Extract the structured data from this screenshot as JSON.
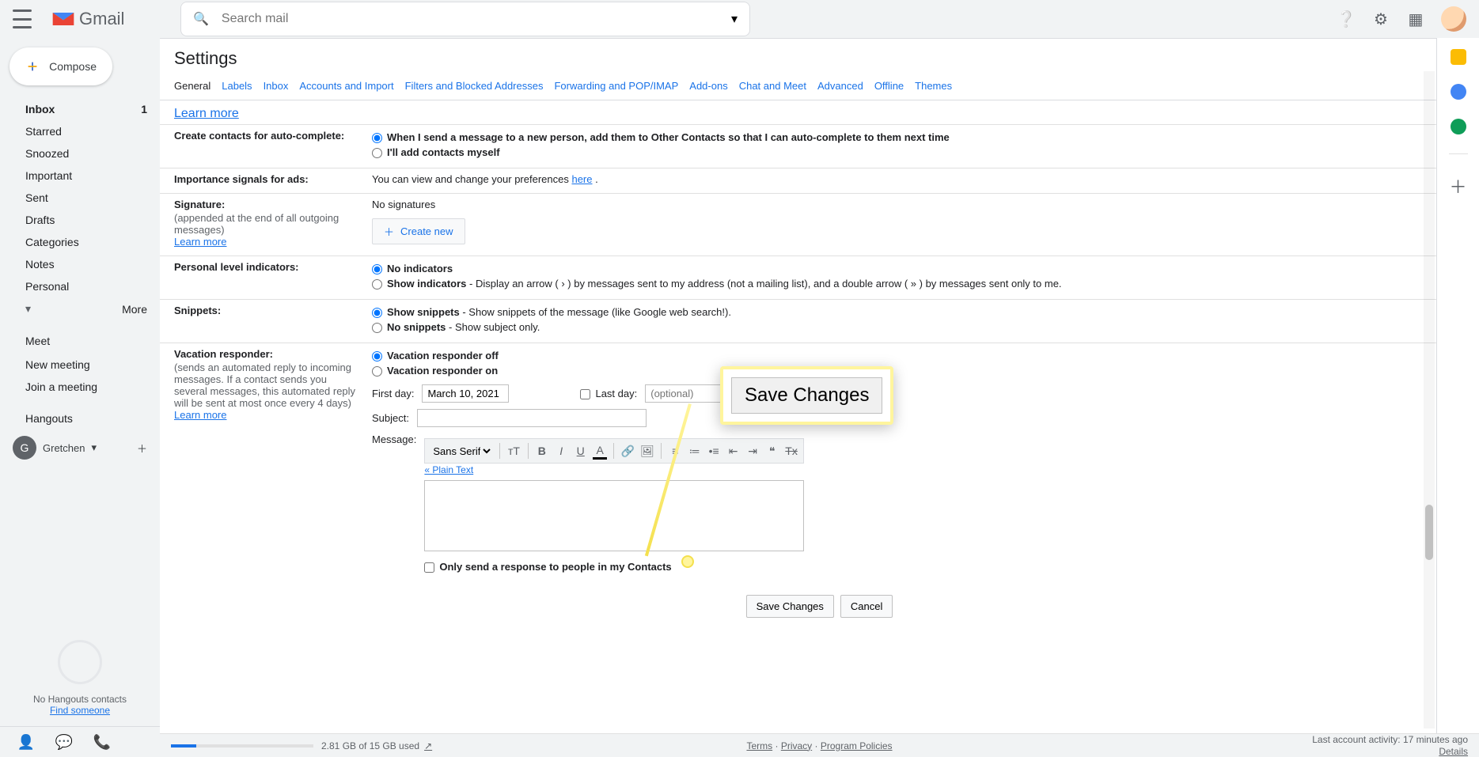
{
  "header": {
    "search_placeholder": "Search mail",
    "logo_text": "Gmail"
  },
  "sidebar": {
    "compose": "Compose",
    "items": [
      {
        "label": "Inbox",
        "count": "1"
      },
      {
        "label": "Starred"
      },
      {
        "label": "Snoozed"
      },
      {
        "label": "Important"
      },
      {
        "label": "Sent"
      },
      {
        "label": "Drafts"
      },
      {
        "label": "Categories"
      },
      {
        "label": "Notes"
      },
      {
        "label": "Personal"
      },
      {
        "label": "More"
      }
    ],
    "meet_label": "Meet",
    "meet_items": [
      {
        "label": "New meeting"
      },
      {
        "label": "Join a meeting"
      }
    ],
    "hangouts_label": "Hangouts",
    "hangouts_user": "Gretchen",
    "no_hangouts": "No Hangouts contacts",
    "find_someone": "Find someone"
  },
  "settings": {
    "title": "Settings",
    "tabs": [
      "General",
      "Labels",
      "Inbox",
      "Accounts and Import",
      "Filters and Blocked Addresses",
      "Forwarding and POP/IMAP",
      "Add-ons",
      "Chat and Meet",
      "Advanced",
      "Offline",
      "Themes"
    ],
    "learn_more": "Learn more",
    "sections": {
      "create_contacts": {
        "label": "Create contacts for auto-complete:",
        "opt1": "When I send a message to a new person, add them to Other Contacts so that I can auto-complete to them next time",
        "opt2": "I'll add contacts myself"
      },
      "importance": {
        "label": "Importance signals for ads:",
        "text_prefix": "You can view and change your preferences ",
        "link": "here",
        "text_suffix": "."
      },
      "signature": {
        "label": "Signature:",
        "sub": "(appended at the end of all outgoing messages)",
        "no_sig": "No signatures",
        "create": "Create new"
      },
      "indicators": {
        "label": "Personal level indicators:",
        "opt1": "No indicators",
        "opt2_bold": "Show indicators",
        "opt2_rest": " - Display an arrow ( › ) by messages sent to my address (not a mailing list), and a double arrow ( » ) by messages sent only to me."
      },
      "snippets": {
        "label": "Snippets:",
        "opt1_bold": "Show snippets",
        "opt1_rest": " - Show snippets of the message (like Google web search!).",
        "opt2_bold": "No snippets",
        "opt2_rest": " - Show subject only."
      },
      "vacation": {
        "label": "Vacation responder:",
        "sub": "(sends an automated reply to incoming messages. If a contact sends you several messages, this automated reply will be sent at most once every 4 days)",
        "off": "Vacation responder off",
        "on": "Vacation responder on",
        "first_day": "First day:",
        "first_day_val": "March 10, 2021",
        "last_day": "Last day:",
        "last_day_placeholder": "(optional)",
        "subject_label": "Subject:",
        "message_label": "Message:",
        "font": "Sans Serif",
        "plain_text": "« Plain Text",
        "only_contacts": "Only send a response to people in my Contacts"
      }
    },
    "save": "Save Changes",
    "cancel": "Cancel"
  },
  "callout": {
    "text": "Save Changes"
  },
  "footer": {
    "storage": "2.81 GB of 15 GB used",
    "storage_pct": 18,
    "links": [
      "Terms",
      "Privacy",
      "Program Policies"
    ],
    "sep": " · ",
    "activity_line1": "Last account activity: 17 minutes ago",
    "activity_line2": "Details"
  }
}
